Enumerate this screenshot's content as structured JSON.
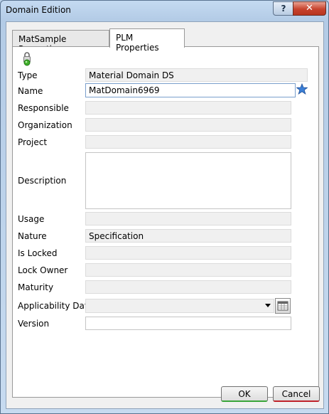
{
  "window": {
    "title": "Domain Edition",
    "help_label": "?",
    "close_label": "✕"
  },
  "tabs": [
    {
      "label": "MatSample Properties",
      "active": false
    },
    {
      "label": "PLM Properties",
      "active": true
    }
  ],
  "icons": {
    "lock": "lock-icon",
    "star": "star-icon",
    "calendar": "calendar-icon",
    "dropdown": "chevron-down-icon"
  },
  "fields": {
    "type": {
      "label": "Type",
      "value": "Material Domain DS"
    },
    "name": {
      "label": "Name",
      "value": "MatDomain6969"
    },
    "responsible": {
      "label": "Responsible",
      "value": ""
    },
    "organization": {
      "label": "Organization",
      "value": ""
    },
    "project": {
      "label": "Project",
      "value": ""
    },
    "description": {
      "label": "Description",
      "value": ""
    },
    "usage": {
      "label": "Usage",
      "value": ""
    },
    "nature": {
      "label": "Nature",
      "value": "Specification"
    },
    "is_locked": {
      "label": "Is Locked",
      "value": ""
    },
    "lock_owner": {
      "label": "Lock Owner",
      "value": ""
    },
    "maturity": {
      "label": "Maturity",
      "value": ""
    },
    "applicability_date": {
      "label": "Applicability Date",
      "value": ""
    },
    "version": {
      "label": "Version",
      "value": ""
    }
  },
  "buttons": {
    "ok": "OK",
    "cancel": "Cancel"
  },
  "colors": {
    "ok_accent": "#3aa53a",
    "cancel_accent": "#c0232a",
    "star": "#3b7fd6",
    "lock": "#3fae2a"
  }
}
